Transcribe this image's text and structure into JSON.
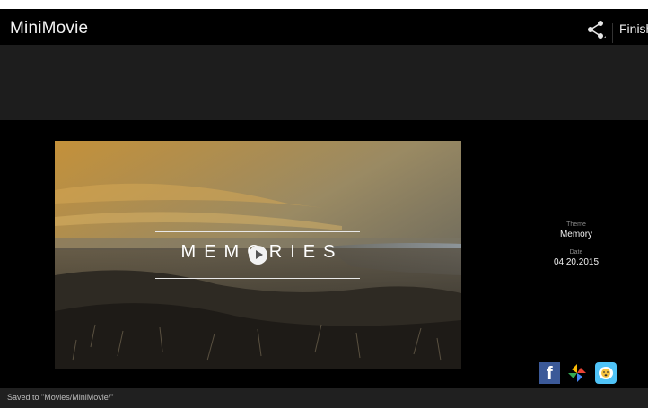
{
  "app": {
    "title": "MiniMovie"
  },
  "toolbar": {
    "share_icon": "share-icon",
    "finish_label": "Finish"
  },
  "preview": {
    "title_text": "MEMORIES",
    "play_icon": "play-icon"
  },
  "info": {
    "theme_label": "Theme",
    "theme_value": "Memory",
    "date_label": "Date",
    "date_value": "04.20.2015"
  },
  "share_targets": [
    {
      "icon": "facebook-icon"
    },
    {
      "icon": "photos-pinwheel-icon"
    },
    {
      "icon": "messenger-icon"
    }
  ],
  "footer": {
    "status": "Saved to \"Movies/MiniMovie/\""
  }
}
